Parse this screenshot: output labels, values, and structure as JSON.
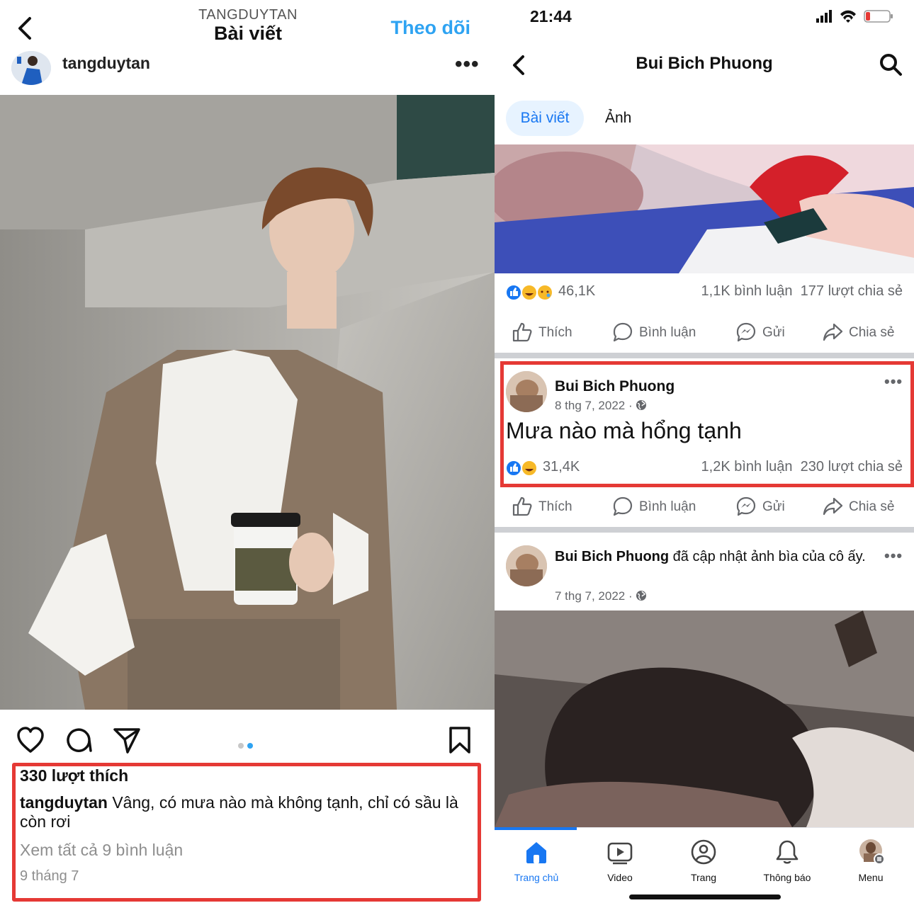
{
  "instagram": {
    "header": {
      "username_top": "TANGDUYTAN",
      "title": "Bài viết",
      "follow_label": "Theo dõi"
    },
    "post": {
      "username": "tangduytan",
      "likes": "330 lượt thích",
      "caption_user": "tangduytan",
      "caption_text": "Vâng, có mưa nào mà không tạnh, chỉ có sầu là còn rơi",
      "view_all_comments": "Xem tất cả 9 bình luận",
      "date": "9 tháng 7",
      "carousel_index": 2,
      "carousel_total": 2
    }
  },
  "facebook": {
    "status": {
      "time": "21:44"
    },
    "nav": {
      "title": "Bui Bich Phuong"
    },
    "tabs": [
      {
        "label": "Bài viết",
        "active": true
      },
      {
        "label": "Ảnh",
        "active": false
      }
    ],
    "actions": {
      "like": "Thích",
      "comment": "Bình luận",
      "send": "Gửi",
      "share": "Chia sẻ"
    },
    "posts": [
      {
        "reactions": "46,1K",
        "comments": "1,1K bình luận",
        "shares": "177 lượt chia sẻ"
      },
      {
        "author": "Bui Bich Phuong",
        "date": "8 thg 7, 2022 ·",
        "text": "Mưa nào mà hổng tạnh",
        "reactions": "31,4K",
        "comments": "1,2K bình luận",
        "shares": "230 lượt chia sẻ"
      },
      {
        "author": "Bui Bich Phuong",
        "activity": " đã cập nhật ảnh bìa của cô ấy.",
        "date": "7 thg 7, 2022 ·"
      }
    ],
    "bottom_nav": [
      {
        "label": "Trang chủ",
        "icon": "home-icon",
        "active": true
      },
      {
        "label": "Video",
        "icon": "video-icon",
        "active": false
      },
      {
        "label": "Trang",
        "icon": "pages-icon",
        "active": false
      },
      {
        "label": "Thông báo",
        "icon": "bell-icon",
        "active": false
      },
      {
        "label": "Menu",
        "icon": "menu-avatar-icon",
        "active": false
      }
    ],
    "colors": {
      "brand": "#1877f2",
      "highlight": "#e53935"
    }
  },
  "instagram_colors": {
    "follow": "#2ea3f2"
  }
}
